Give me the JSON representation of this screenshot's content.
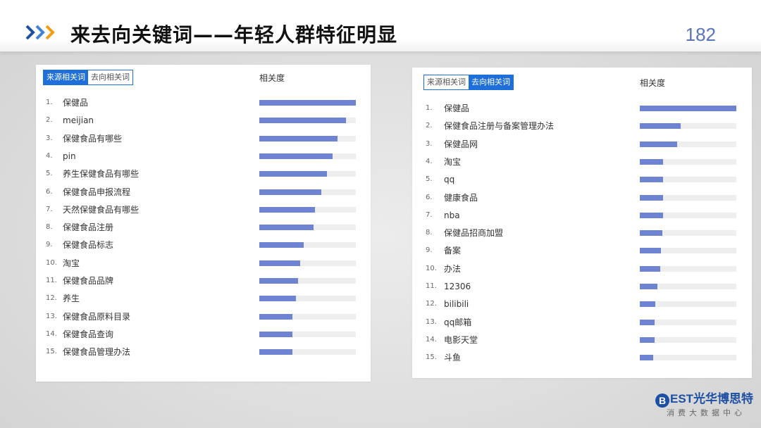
{
  "header": {
    "title": "来去向关键词——年轻人群特征明显",
    "page_number": "182"
  },
  "colors": {
    "accent": "#1e6fd9",
    "bar": "#6e84d2",
    "track": "#eeeeee",
    "chevron_dark": "#1d4fa3",
    "chevron_light": "#f39c12"
  },
  "icons": {
    "header": "chevron-arrows-icon"
  },
  "chart_data": [
    {
      "type": "bar",
      "tabs": [
        "来源相关词",
        "去向相关词"
      ],
      "active_tab": "来源相关词",
      "value_header": "相关度",
      "ranks": [
        "1.",
        "2.",
        "3.",
        "4.",
        "5.",
        "6.",
        "7.",
        "8.",
        "9.",
        "10.",
        "11.",
        "12.",
        "13.",
        "14.",
        "15."
      ],
      "categories": [
        "保健品",
        "meijian",
        "保健食品有哪些",
        "pin",
        "养生保健食品有哪些",
        "保健食品申报流程",
        "天然保健食品有哪些",
        "保健食品注册",
        "保健食品标志",
        "淘宝",
        "保健食品品牌",
        "养生",
        "保健食品原料目录",
        "保健食品查询",
        "保健食品管理办法"
      ],
      "values": [
        100,
        90,
        81,
        76,
        70,
        64,
        58,
        56,
        46,
        42,
        40,
        38,
        34,
        34,
        34
      ],
      "ylim": [
        0,
        100
      ]
    },
    {
      "type": "bar",
      "tabs": [
        "来源相关词",
        "去向相关词"
      ],
      "active_tab": "去向相关词",
      "value_header": "相关度",
      "ranks": [
        "1.",
        "2.",
        "3.",
        "4.",
        "5.",
        "6.",
        "7.",
        "8.",
        "9.",
        "10.",
        "11.",
        "12.",
        "13.",
        "14.",
        "15."
      ],
      "categories": [
        "保健品",
        "保健食品注册与备案管理办法",
        "保健品网",
        "淘宝",
        "qq",
        "健康食品",
        "nba",
        "保健品招商加盟",
        "备案",
        "办法",
        "12306",
        "bilibili",
        "qq邮箱",
        "电影天堂",
        "斗鱼"
      ],
      "values": [
        100,
        42,
        39,
        24,
        24,
        24,
        24,
        23,
        22,
        21,
        18,
        16,
        15,
        15,
        14
      ],
      "ylim": [
        0,
        100
      ]
    }
  ],
  "logo": {
    "main": "EST光华博思特",
    "b_letter": "B",
    "subtitle": "消费大数据中心"
  }
}
